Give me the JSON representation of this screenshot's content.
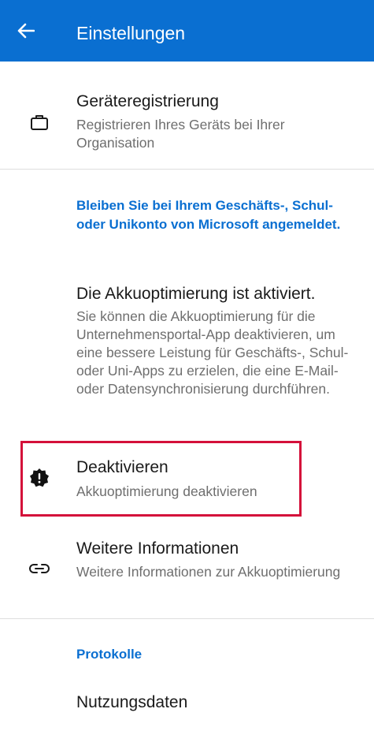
{
  "appbar": {
    "title": "Einstellungen",
    "back_icon": "arrow-left-icon"
  },
  "device_registration": {
    "icon": "briefcase-icon",
    "title": "Geräteregistrierung",
    "subtitle": "Registrieren Ihres Geräts bei Ihrer Organisation"
  },
  "battery_section": {
    "heading": "Bleiben Sie bei Ihrem Geschäfts-, Schul- oder Unikonto von Microsoft angemeldet.",
    "status_title": "Die Akkuoptimierung ist aktiviert.",
    "status_text": "Sie können die Akkuoptimierung für die Unternehmensportal-App deaktivieren, um eine bessere Leistung für Geschäfts-, Schul- oder Uni-Apps zu erzielen, die eine E-Mail- oder Datensynchronisierung durchführen."
  },
  "deactivate": {
    "icon": "alert-badge-icon",
    "title": "Deaktivieren",
    "subtitle": "Akkuoptimierung deaktivieren",
    "highlight_color": "#d4103a"
  },
  "more_info": {
    "icon": "link-icon",
    "title": "Weitere Informationen",
    "subtitle": "Weitere Informationen zur Akkuoptimierung"
  },
  "logs_section": {
    "heading": "Protokolle",
    "usage_title": "Nutzungsdaten"
  },
  "colors": {
    "accent": "#0a6fd1",
    "highlight": "#d4103a"
  }
}
